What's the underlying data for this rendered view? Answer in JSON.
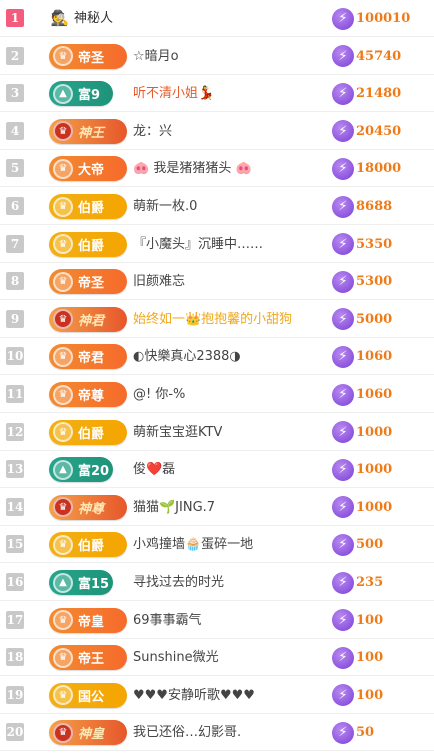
{
  "rows": [
    {
      "rank": "1",
      "badge": null,
      "avatar_icon": "masked-agent-icon",
      "name": "神秘人",
      "score": "100010"
    },
    {
      "rank": "2",
      "badge": {
        "label": "帝圣",
        "style": "orange"
      },
      "name": "☆暗月o",
      "score": "45740"
    },
    {
      "rank": "3",
      "badge": {
        "label": "富9",
        "style": "teal"
      },
      "name": "听不清小姐💃",
      "name_style": "hl",
      "score": "21480"
    },
    {
      "rank": "4",
      "badge": {
        "label": "神王",
        "style": "red"
      },
      "name": "龙：兴",
      "score": "20450"
    },
    {
      "rank": "5",
      "badge": {
        "label": "大帝",
        "style": "orange"
      },
      "name": "🐽 我是猪猪猪头 🐽",
      "score": "18000"
    },
    {
      "rank": "6",
      "badge": {
        "label": "伯爵",
        "style": "gold"
      },
      "name": "萌新一枚.0",
      "score": "8688"
    },
    {
      "rank": "7",
      "badge": {
        "label": "伯爵",
        "style": "gold"
      },
      "name": "『小魔头』沉睡中……",
      "score": "5350"
    },
    {
      "rank": "8",
      "badge": {
        "label": "帝圣",
        "style": "orange"
      },
      "name": "旧颜难忘",
      "score": "5300"
    },
    {
      "rank": "9",
      "badge": {
        "label": "神君",
        "style": "red"
      },
      "name": "始终如一👑抱抱馨的小甜狗",
      "name_style": "gold",
      "score": "5000"
    },
    {
      "rank": "10",
      "badge": {
        "label": "帝君",
        "style": "orange"
      },
      "name": "◐快樂真心2388◑",
      "score": "1060"
    },
    {
      "rank": "11",
      "badge": {
        "label": "帝尊",
        "style": "orange"
      },
      "name": "@! 你-%",
      "score": "1060"
    },
    {
      "rank": "12",
      "badge": {
        "label": "伯爵",
        "style": "gold"
      },
      "name": "萌新宝宝逛KTV",
      "score": "1000"
    },
    {
      "rank": "13",
      "badge": {
        "label": "富20",
        "style": "teal"
      },
      "name": "俊❤️磊",
      "score": "1000"
    },
    {
      "rank": "14",
      "badge": {
        "label": "神尊",
        "style": "red"
      },
      "name": "猫猫🌱JING.7",
      "score": "1000"
    },
    {
      "rank": "15",
      "badge": {
        "label": "伯爵",
        "style": "gold"
      },
      "name": "小鸡撞墙🧁蛋碎一地",
      "score": "500"
    },
    {
      "rank": "16",
      "badge": {
        "label": "富15",
        "style": "teal"
      },
      "name": "寻找过去的时光",
      "score": "235"
    },
    {
      "rank": "17",
      "badge": {
        "label": "帝皇",
        "style": "orange"
      },
      "name": "69事事霸气",
      "score": "100"
    },
    {
      "rank": "18",
      "badge": {
        "label": "帝王",
        "style": "orange"
      },
      "name": "Sunshine微光",
      "score": "100"
    },
    {
      "rank": "19",
      "badge": {
        "label": "国公",
        "style": "gold"
      },
      "name": "♥♥♥安静听歌♥♥♥",
      "score": "100"
    },
    {
      "rank": "20",
      "badge": {
        "label": "神皇",
        "style": "red"
      },
      "name": "我已还俗…幻影哥.",
      "score": "50"
    }
  ],
  "colors": {
    "rank_first": "#f55b7c",
    "rank_default": "#c9c9c9",
    "score": "#ee7a18",
    "bolt": "#7a3ed6"
  }
}
